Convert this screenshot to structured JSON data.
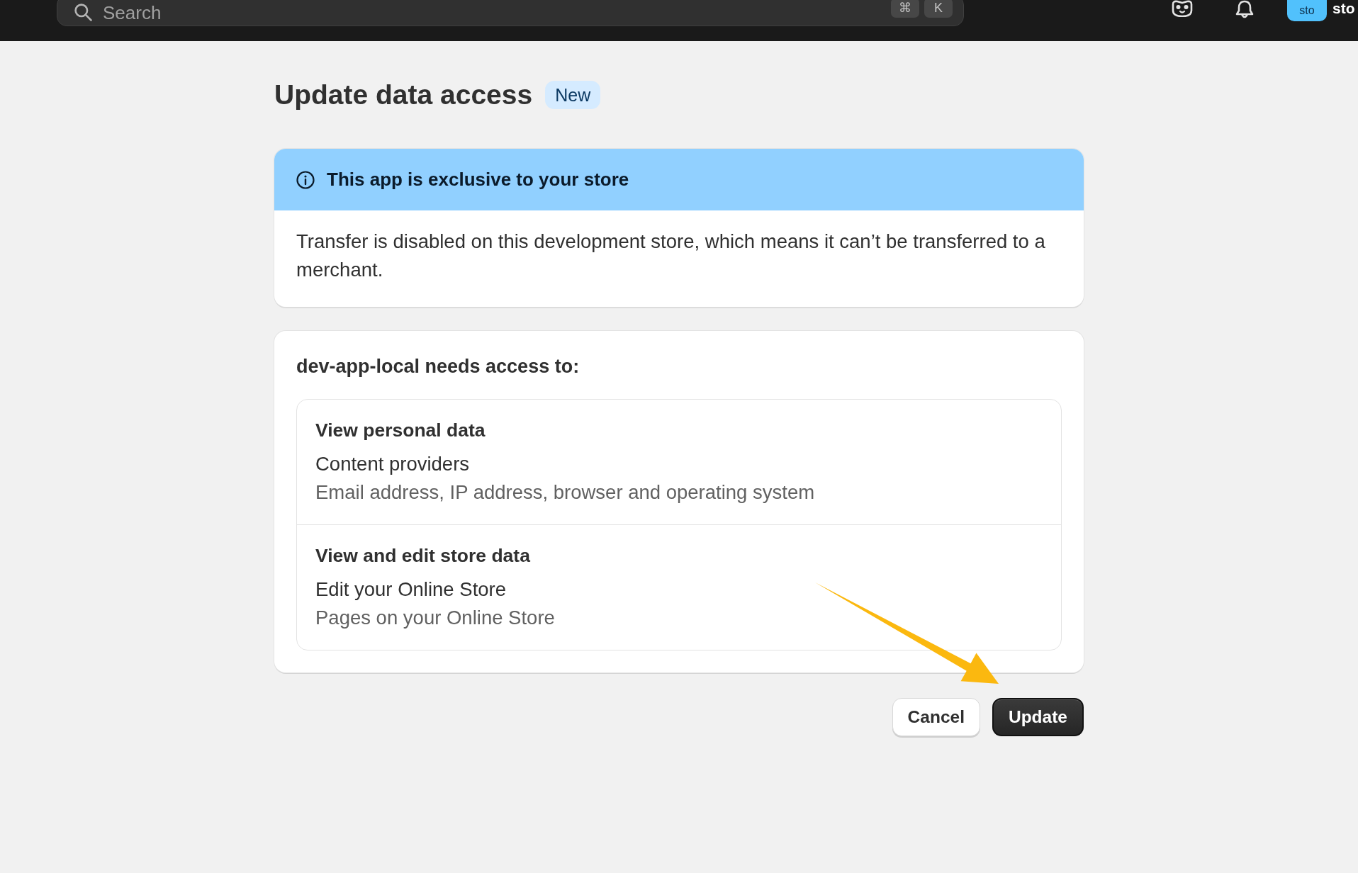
{
  "top_bar": {
    "search": {
      "placeholder": "Search",
      "shortcut_keys": [
        "⌘",
        "K"
      ]
    },
    "avatar_initials": "sto",
    "store_name": "sto"
  },
  "page": {
    "title": "Update data access",
    "badge": "New"
  },
  "banner": {
    "title": "This app is exclusive to your store",
    "body": "Transfer is disabled on this development store, which means it can’t be transferred to a merchant."
  },
  "access": {
    "heading": "dev-app-local needs access to:",
    "permissions": [
      {
        "title": "View personal data",
        "scope": "Content providers",
        "detail": "Email address, IP address, browser and operating system"
      },
      {
        "title": "View and edit store data",
        "scope": "Edit your Online Store",
        "detail": "Pages on your Online Store"
      }
    ]
  },
  "actions": [
    {
      "label": "Cancel",
      "kind": "secondary"
    },
    {
      "label": "Update",
      "kind": "primary"
    }
  ]
}
